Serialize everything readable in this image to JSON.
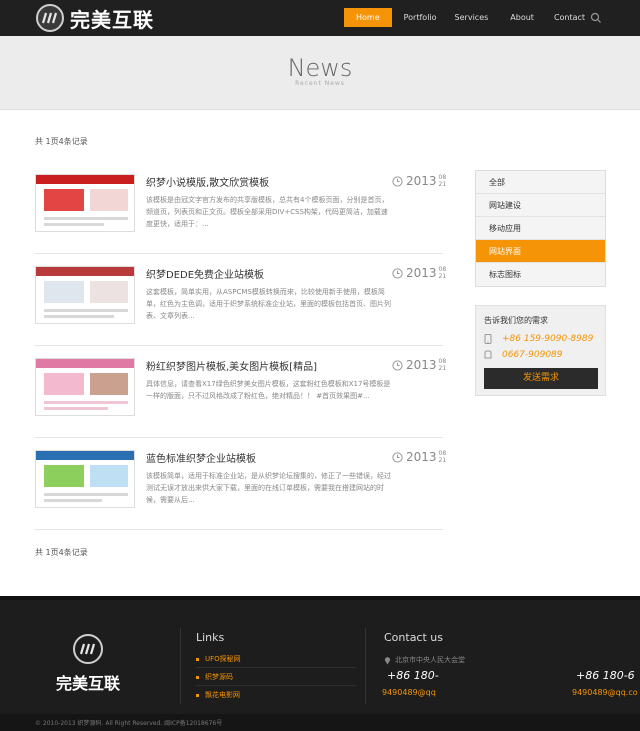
{
  "header": {
    "logo_text": "完美互联",
    "nav": [
      {
        "label": "Home",
        "active": true
      },
      {
        "label": "Portfolio",
        "active": false
      },
      {
        "label": "Services",
        "active": false
      },
      {
        "label": "About",
        "active": false
      },
      {
        "label": "Contact",
        "active": false
      }
    ],
    "search_icon": "search-icon",
    "accent_color": "#f49406"
  },
  "banner": {
    "title": "News",
    "subtitle": "Recent News"
  },
  "records_top": "共 1页4条记录",
  "records_bottom": "共 1页4条记录",
  "articles": [
    {
      "title": "织梦小说模版,散文欣赏模板",
      "desc": "该模板是由冠文字官方发布的共享版模板，总共有4个模板页面，分别是首页，频道页，列表页和正文页。模板全部采用DIV+CSS构架，代码更简洁，加载速度更快，适用于：...",
      "year": "2013",
      "month": "08",
      "day": "21"
    },
    {
      "title": "织梦DEDE免费企业站模板",
      "desc": "这套模板，简单实用，从ASPCMS模板转换而来，比较使用新手使用，模板简单，红色为主色调，适用于织梦系统标准企业站，里面的模板包括首页、图片列表、文章列表...",
      "year": "2013",
      "month": "08",
      "day": "21"
    },
    {
      "title": "粉红织梦图片模板,美女图片模板[精品]",
      "desc": "具体信息，请查看X17绿色织梦美女图片模板，这套粉红色模板和X17号模板是一样的版面，只不过风格改成了粉红色，绝对精品！！ #首页效果图#...",
      "year": "2013",
      "month": "08",
      "day": "21"
    },
    {
      "title": "蓝色标准织梦企业站模板",
      "desc": "该模板简单，适用于标准企业站，是从织梦论坛搜集的，修正了一些错误，经过测试无误才放出来供大家下载，里面的在线订单模板，需要我在搭建网站的时候，需要从后...",
      "year": "2013",
      "month": "08",
      "day": "21"
    }
  ],
  "sidebar": {
    "categories": [
      {
        "label": "全部",
        "active": false
      },
      {
        "label": "网站建设",
        "active": false
      },
      {
        "label": "移动应用",
        "active": false
      },
      {
        "label": "网站界面",
        "active": true
      },
      {
        "label": "标志图标",
        "active": false
      }
    ],
    "contact": {
      "title": "告诉我们您的需求",
      "phone": "+86 159-9090-8989",
      "tel": "0667-909089",
      "button": "发送需求"
    }
  },
  "footer": {
    "logo_text": "完美互联",
    "links_title": "Links",
    "links": [
      "UFO探秘网",
      "织梦源码",
      "飘花电影网"
    ],
    "contact_title": "Contact us",
    "address": "北京市中央人民大会堂",
    "phone_partial": "+86 180-",
    "qq_partial": "9490489@qq",
    "phone_partial_2": "+86 180-6",
    "qq_partial_2": "9490489@qq.co",
    "copyright": "© 2010-2013 织梦源码. All Right Reserved. 闽ICP备12018676号"
  }
}
